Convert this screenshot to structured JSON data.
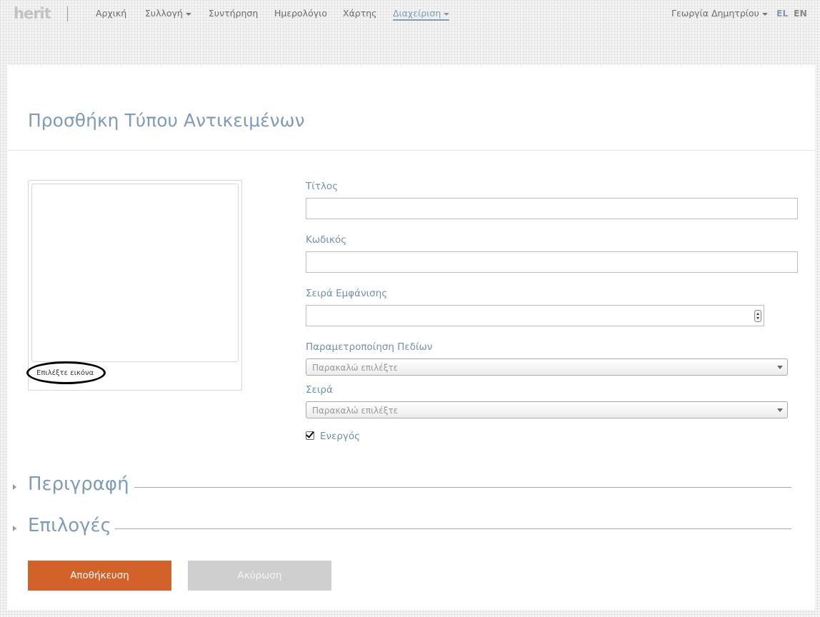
{
  "header": {
    "logo": "herit",
    "nav": [
      {
        "label": "Αρχική"
      },
      {
        "label": "Συλλογή"
      },
      {
        "label": "Συντήρηση"
      },
      {
        "label": "Ημερολόγιο"
      },
      {
        "label": "Χάρτης"
      },
      {
        "label": "Διαχείριση"
      }
    ],
    "active_nav": "Διαχείριση",
    "user": "Γεωργία Δημητρίου",
    "languages": [
      "EL",
      "EN"
    ],
    "active_language": "EL"
  },
  "page": {
    "title": "Προσθήκη Τύπου Αντικειμένων"
  },
  "image_panel": {
    "select_label": "Επιλέξτε εικόνα"
  },
  "form": {
    "title": {
      "label": "Τίτλος",
      "value": ""
    },
    "code": {
      "label": "Κωδικός",
      "value": ""
    },
    "display_order": {
      "label": "Σειρά Εμφάνισης",
      "value": ""
    },
    "field_config": {
      "label": "Παραμετροποίηση Πεδίων",
      "placeholder": "Παρακαλώ επιλέξτε"
    },
    "series": {
      "label": "Σειρά",
      "placeholder": "Παρακαλώ επιλέξτε"
    },
    "active": {
      "label": "Ενεργός",
      "checked": true
    }
  },
  "sections": {
    "description": "Περιγραφή",
    "options": "Επιλογές"
  },
  "actions": {
    "save": "Αποθήκευση",
    "cancel": "Ακύρωση"
  },
  "colors": {
    "accent": "#7f9bb7",
    "save_button": "#d2612a",
    "cancel_button": "#cfcfcf"
  }
}
